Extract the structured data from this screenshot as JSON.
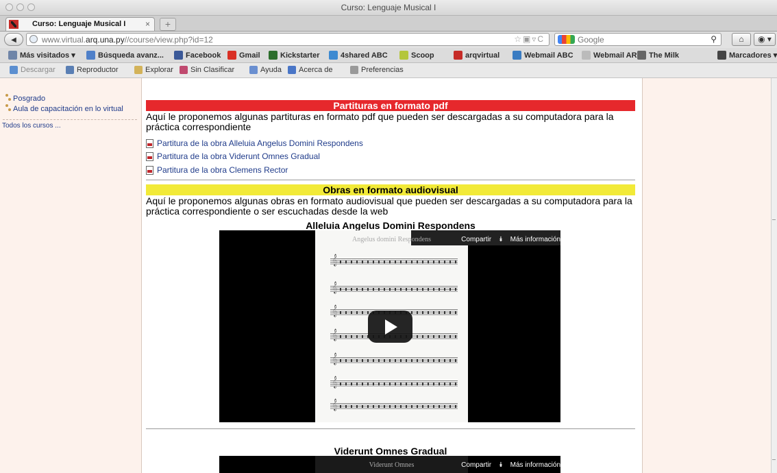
{
  "window": {
    "title": "Curso: Lenguaje Musical I"
  },
  "tab": {
    "label": "Curso: Lenguaje Musical I",
    "close": "×",
    "new_tab": "+"
  },
  "nav": {
    "url_host": "www.virtual.arq.una.py",
    "url_host_bold": "arq.una.py",
    "url_path": "//course/view.php?id=12",
    "search_placeholder": "Google",
    "back_icon": "back-arrow-icon",
    "home_icon": "home-icon"
  },
  "bookmarks": [
    {
      "label": "Más visitados ▾",
      "icon": "folder-icon",
      "color": "#6f85a8"
    },
    {
      "label": "Búsqueda avanz...",
      "icon": "search-engine-icon",
      "color": "#4f80c9"
    },
    {
      "label": "Facebook",
      "icon": "facebook-icon",
      "color": "#3b5998"
    },
    {
      "label": "Gmail",
      "icon": "gmail-icon",
      "color": "#d93025"
    },
    {
      "label": "Kickstarter",
      "icon": "kickstarter-icon",
      "color": "#2c6e2c"
    },
    {
      "label": "4shared ABC",
      "icon": "4shared-icon",
      "color": "#3d8ad1"
    },
    {
      "label": "Scoop",
      "icon": "scoop-icon",
      "color": "#b4c63c"
    },
    {
      "label": "arqvirtual",
      "icon": "arqvirtual-icon",
      "color": "#c62b27"
    },
    {
      "label": "Webmail ABC",
      "icon": "webmail-icon",
      "color": "#3a7cc2"
    },
    {
      "label": "Webmail ARQ",
      "icon": "webmail-icon",
      "color": "#bbbbbb"
    },
    {
      "label": "The Milk",
      "icon": "milk-icon",
      "color": "#666666"
    },
    {
      "label": "Marcadores ▾",
      "icon": "bookmarks-icon",
      "color": "#444444"
    }
  ],
  "toolbar": [
    {
      "label": "Descargar",
      "icon": "download-icon",
      "color": "#5c8fd0",
      "muted": true
    },
    {
      "label": "Reproductor",
      "icon": "player-icon",
      "color": "#5a7fb4"
    },
    {
      "label": "Explorar",
      "icon": "explore-icon",
      "color": "#d3b35a"
    },
    {
      "label": "Sin Clasificar",
      "icon": "unclassified-icon",
      "color": "#c04a6f"
    },
    {
      "label": "Ayuda",
      "icon": "help-icon",
      "color": "#6a8fd0"
    },
    {
      "label": "Acerca de",
      "icon": "about-icon",
      "color": "#4a76c7"
    },
    {
      "label": "Preferencias",
      "icon": "preferences-icon",
      "color": "#999999"
    }
  ],
  "sidebar": {
    "items": [
      "Posgrado",
      "Aula de capacitación en lo virtual"
    ],
    "all_courses": "Todos los cursos ..."
  },
  "main": {
    "pdf_section": {
      "header": "Partituras en formato pdf",
      "intro": "Aquí le proponemos algunas partituras en formato pdf que pueden ser descargadas a su computadora para la práctica correspondiente",
      "links": [
        "Partitura de la obra Alleluia Angelus Domini Respondens",
        "Partitura de la obra Viderunt Omnes Gradual",
        "Partitura de la obra Clemens Rector"
      ]
    },
    "av_section": {
      "header": "Obras en formato audiovisual",
      "intro": "Aquí le proponemos algunas obras en formato audiovisual que pueden ser descargadas a su computadora para la práctica correspondiente o ser escuchadas desde la web",
      "videos": [
        {
          "title": "Alleluia Angelus Domini Respondens",
          "share": "Compartir",
          "more": "Más información",
          "sheet_title": "Angelus domini  Respondens"
        },
        {
          "title": "Viderunt Omnes Gradual",
          "share": "Compartir",
          "more": "Más información",
          "sheet_title": "Viderunt Omnes"
        }
      ]
    }
  }
}
